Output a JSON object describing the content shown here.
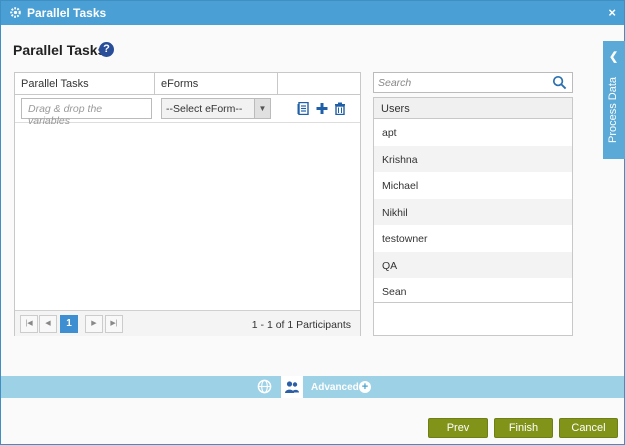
{
  "window": {
    "title": "Parallel Tasks",
    "close_label": "×"
  },
  "page": {
    "title": "Parallel Tasks",
    "help_label": "?"
  },
  "grid": {
    "columns": [
      "Parallel Tasks",
      "eForms",
      ""
    ],
    "row": {
      "drag_placeholder": "Drag & drop the variables",
      "select_value": "--Select eForm--"
    },
    "pager": {
      "current_page": "1",
      "info": "1 - 1 of 1 Participants"
    }
  },
  "users_panel": {
    "search_placeholder": "Search",
    "header": "Users",
    "items": [
      "apt",
      "Krishna",
      "Michael",
      "Nikhil",
      "testowner",
      "QA",
      "Sean"
    ]
  },
  "side_panel": {
    "label": "Process Data"
  },
  "advanced_bar": {
    "label": "Advanced"
  },
  "footer": {
    "prev_label": "Prev",
    "finish_label": "Finish",
    "cancel_label": "Cancel"
  },
  "colors": {
    "titlebar": "#4a9fd5",
    "accent": "#3d8fd1",
    "button": "#82931a",
    "bar": "#9cd1e6"
  }
}
